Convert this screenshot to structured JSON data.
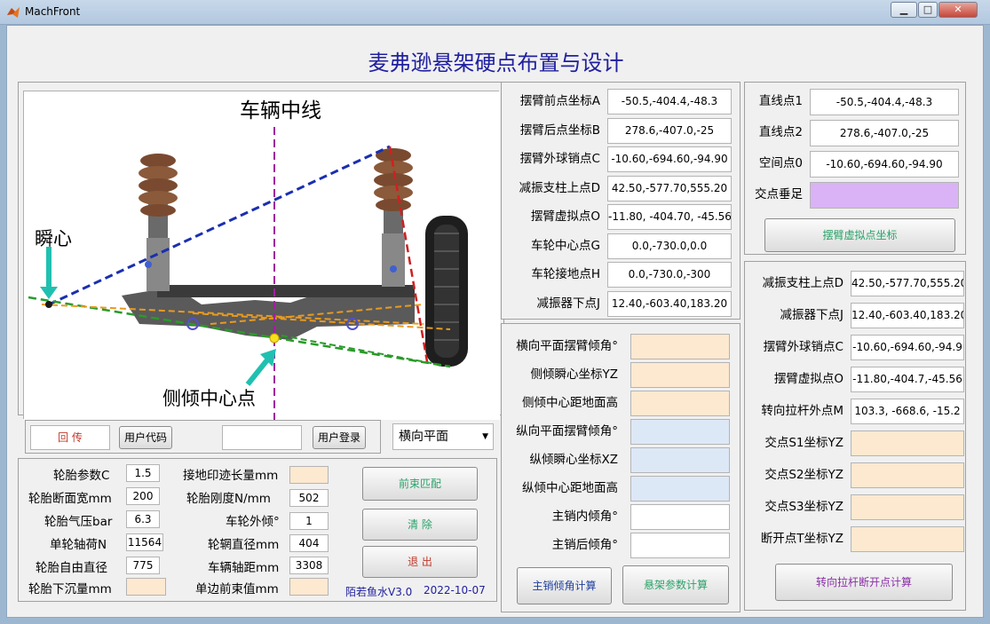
{
  "window": {
    "title": "MachFront",
    "min": "▁",
    "max": "□",
    "close": "✕"
  },
  "main_title": "麦弗逊悬架硬点布置与设计",
  "diagram": {
    "center_line": "车辆中线",
    "instant_center": "瞬心",
    "roll_center": "侧倾中心点"
  },
  "controls": {
    "return_label": "回 传",
    "user_code_btn": "用户代码",
    "user_login_value": "",
    "user_login_btn": "用户登录",
    "plane_select": "横向平面",
    "dropdown_arrow": "▼"
  },
  "params": {
    "tire_param_label": "轮胎参数C",
    "tire_param": "1.5",
    "tire_width_label": "轮胎断面宽mm",
    "tire_width": "200",
    "tire_pressure_label": "轮胎气压bar",
    "tire_pressure": "6.3",
    "wheel_load_label": "单轮轴荷N",
    "wheel_load": "11564",
    "tire_diameter_label": "轮胎自由直径",
    "tire_diameter": "775",
    "tire_sink_label": "轮胎下沉量mm",
    "tire_sink": "",
    "contact_len_label": "接地印迹长量mm",
    "contact_len": "",
    "tire_stiff_label": "轮胎刚度N/mm",
    "tire_stiff": "502",
    "camber_label": "车轮外倾°",
    "camber": "1",
    "rim_dia_label": "轮辋直径mm",
    "rim_dia": "404",
    "wheelbase_label": "车辆轴距mm",
    "wheelbase": "3308",
    "toe_label": "单边前束值mm",
    "toe": ""
  },
  "buttons": {
    "toe_match": "前束匹配",
    "clear": "清 除",
    "exit": "退 出",
    "kingpin_calc": "主销倾角计算",
    "susp_calc": "悬架参数计算",
    "virtual_pt_calc": "摆臂虚拟点坐标",
    "tie_rod_calc": "转向拉杆断开点计算"
  },
  "footer": {
    "author": "陌若鱼水V3.0",
    "date": "2022-10-07"
  },
  "hardpoints": [
    {
      "label": "摆臂前点坐标A",
      "value": "-50.5,-404.4,-48.3"
    },
    {
      "label": "摆臂后点坐标B",
      "value": "278.6,-407.0,-25"
    },
    {
      "label": "摆臂外球销点C",
      "value": "-10.60,-694.60,-94.90"
    },
    {
      "label": "减振支柱上点D",
      "value": "42.50,-577.70,555.20"
    },
    {
      "label": "摆臂虚拟点O",
      "value": "-11.80, -404.70, -45.56"
    },
    {
      "label": "车轮中心点G",
      "value": "0.0,-730.0,0.0"
    },
    {
      "label": "车轮接地点H",
      "value": "0.0,-730.0,-300"
    },
    {
      "label": "减振器下点J",
      "value": "12.40,-603.40,183.20"
    }
  ],
  "results": [
    {
      "label": "横向平面摆臂倾角°",
      "value": "",
      "color": "#fde9d0"
    },
    {
      "label": "侧倾瞬心坐标YZ",
      "value": "",
      "color": "#fde9d0"
    },
    {
      "label": "侧倾中心距地面高",
      "value": "",
      "color": "#fde9d0"
    },
    {
      "label": "纵向平面摆臂倾角°",
      "value": "",
      "color": "#dde8f7"
    },
    {
      "label": "纵倾瞬心坐标XZ",
      "value": "",
      "color": "#dde8f7"
    },
    {
      "label": "纵倾中心距地面高",
      "value": "",
      "color": "#dde8f7"
    },
    {
      "label": "主销内倾角°",
      "value": "",
      "color": "#ffffff"
    },
    {
      "label": "主销后倾角°",
      "value": "",
      "color": "#ffffff"
    }
  ],
  "lines": [
    {
      "label": "直线点1",
      "value": "-50.5,-404.4,-48.3"
    },
    {
      "label": "直线点2",
      "value": "278.6,-407.0,-25"
    },
    {
      "label": "空间点0",
      "value": "-10.60,-694.60,-94.90"
    },
    {
      "label": "交点垂足",
      "value": ""
    }
  ],
  "tierod": [
    {
      "label": "减振支柱上点D",
      "value": "42.50,-577.70,555.20",
      "color": "#ffffff"
    },
    {
      "label": "减振器下点J",
      "value": "12.40,-603.40,183.20",
      "color": "#ffffff"
    },
    {
      "label": "摆臂外球销点C",
      "value": "-10.60,-694.60,-94.9",
      "color": "#ffffff"
    },
    {
      "label": "摆臂虚拟点O",
      "value": "-11.80,-404.7,-45.56",
      "color": "#ffffff"
    },
    {
      "label": "转向拉杆外点M",
      "value": "103.3, -668.6, -15.2",
      "color": "#ffffff"
    },
    {
      "label": "交点S1坐标YZ",
      "value": "",
      "color": "#fde9d0"
    },
    {
      "label": "交点S2坐标YZ",
      "value": "",
      "color": "#fde9d0"
    },
    {
      "label": "交点S3坐标YZ",
      "value": "",
      "color": "#fde9d0"
    },
    {
      "label": "断开点T坐标YZ",
      "value": "",
      "color": "#fde9d0"
    }
  ],
  "colors": {
    "title": "#2020a0",
    "peach": "#fde9d0",
    "lightblue": "#dde8f7",
    "purple": "#d9b3f5",
    "green_text": "#2aa36a",
    "red_text": "#c0392b",
    "purple_text": "#8b2fa8",
    "blue_text": "#2040a0"
  }
}
